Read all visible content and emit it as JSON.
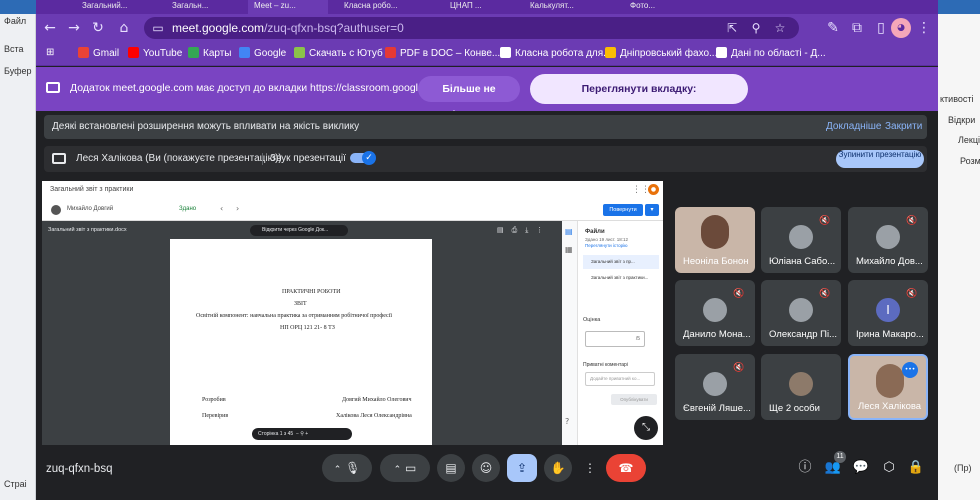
{
  "background_app": {
    "left_labels": [
      "Файл",
      "Вста",
      "Буфер",
      "Страі"
    ],
    "right_labels": [
      "ктивості",
      "Відкри",
      "Лекці",
      "Розмі",
      "(Пр)"
    ]
  },
  "browser": {
    "tabs": [
      "Загальний...",
      "Загальн...",
      "Meet – zu...",
      "Класна робо...",
      "ЦНАП ...",
      "Калькулят...",
      "Фото..."
    ],
    "url_host": "meet.google.com",
    "url_path": "/zuq-qfxn-bsq?authuser=0",
    "bookmarks": [
      {
        "label": "Gmail",
        "color": "#ea4335"
      },
      {
        "label": "YouTube",
        "color": "#ff0000"
      },
      {
        "label": "Карты",
        "color": "#34a853"
      },
      {
        "label": "Google",
        "color": "#4285f4"
      },
      {
        "label": "Скачать с Ютуб",
        "color": "#8bc34a"
      },
      {
        "label": "PDF в DOC – Конве...",
        "color": "#e53935"
      },
      {
        "label": "Класна робота для...",
        "color": "#ffffff"
      },
      {
        "label": "Дніпровський фахо...",
        "color": "#fbbc04"
      },
      {
        "label": "Дані по області - Д...",
        "color": "#ffffff"
      }
    ]
  },
  "infobar": {
    "text": "Додаток meet.google.com має доступ до вкладки https://classroom.google.com",
    "stop_sharing": "Більше не ділитися",
    "view_tab": "Переглянути вкладку: classroom.google.com"
  },
  "meet": {
    "extensions_notice": "Деякі встановлені розширення можуть впливати на якість виклику",
    "details_link": "Докладніше",
    "close_link": "Закрити",
    "presenter": "Леся Халікова (Ви (покажуєте презентацію))",
    "audio_label": "Звук презентації",
    "stop_presenting": "Зупинити презентацію",
    "meeting_code": "zuq-qfxn-bsq",
    "participant_count": "11"
  },
  "classroom": {
    "doc_title": "Загальний звіт з практики",
    "user": "Михайло Довгий",
    "status": "Здано",
    "return_button": "Повернути",
    "file_name": "Загальний звіт з практики.docx",
    "open_with": "Відкрити через Google Док...",
    "page_lines": [
      "ПРАКТИЧНІ РОБОТИ",
      "ЗВІТ",
      "Освітній компонент: навчальна практика за отриманням робітничої професії",
      "НП ОРЦ 121 21- 8 ТЗ"
    ],
    "signoff": [
      {
        "role": "Розробив",
        "name": "Довгий Михайло Олегович"
      },
      {
        "role": "Перевірив",
        "name": "Халікова Леся Олександрівна"
      }
    ],
    "pager": "Сторінка 1 з 45",
    "side_files_label": "Файли",
    "side_submitted": "Здано 19 лист. 18:12",
    "side_history": "Переглянути історію",
    "side_items": [
      "Загальний звіт з пр...",
      "Загальний звіт з практики..."
    ],
    "grade_label": "Оцінка",
    "grade_value": "/5",
    "private_comments": "Приватні коментарі",
    "comment_placeholder": "Додайте приватний ко...",
    "publish": "Опублікувати"
  },
  "participants": [
    {
      "name": "Неоніла Бонон",
      "muted": false,
      "kind": "photo"
    },
    {
      "name": "Юліана Сабо...",
      "muted": true,
      "kind": "avatar"
    },
    {
      "name": "Михайло Дов...",
      "muted": true,
      "kind": "avatar"
    },
    {
      "name": "Данило Мона...",
      "muted": true,
      "kind": "avatar"
    },
    {
      "name": "Олександр Пі...",
      "muted": true,
      "kind": "avatar"
    },
    {
      "name": "Ірина Макаро...",
      "muted": true,
      "kind": "letter",
      "letter": "І"
    },
    {
      "name": "Євгеній Ляше...",
      "muted": true,
      "kind": "avatar"
    },
    {
      "name": "Ще 2 особи",
      "muted": false,
      "kind": "group"
    },
    {
      "name": "Леся Халікова",
      "muted": false,
      "kind": "self"
    }
  ]
}
